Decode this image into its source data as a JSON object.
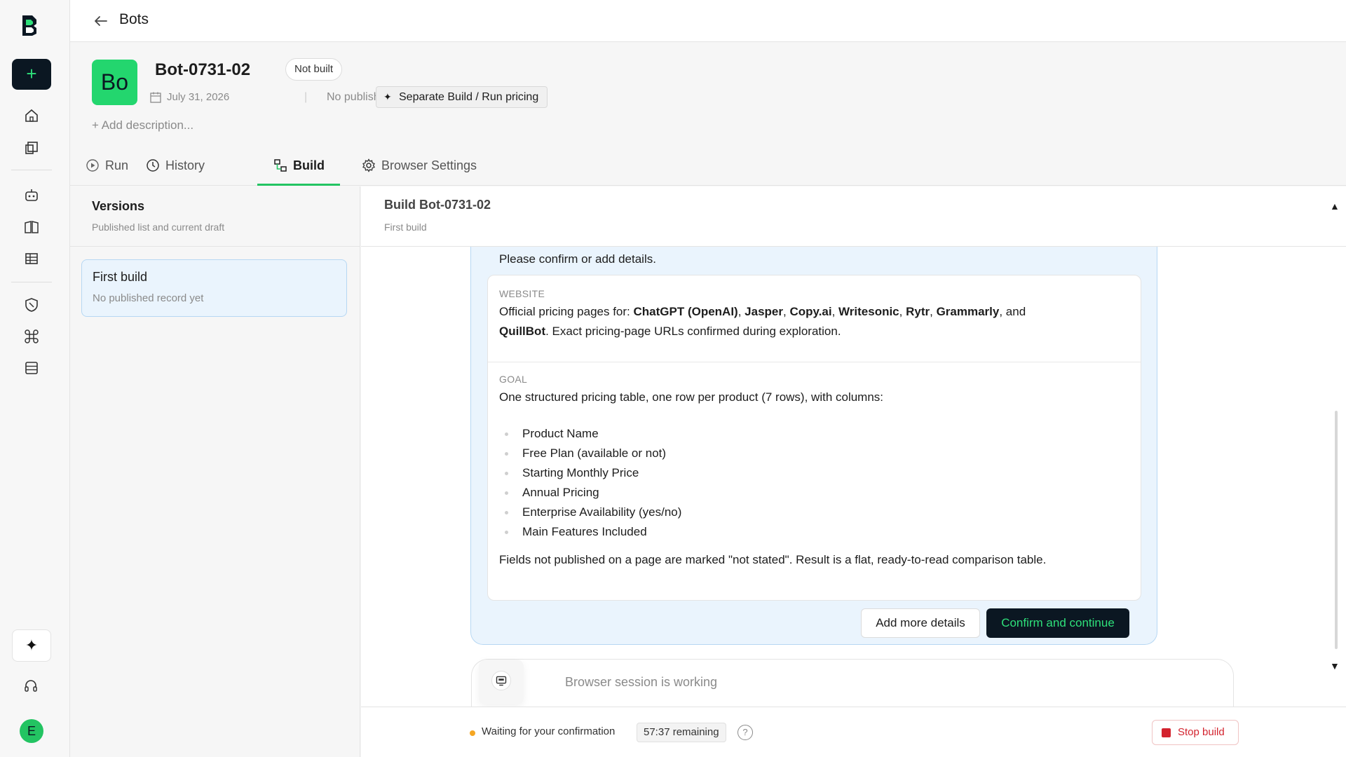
{
  "topbar": {
    "title": "Bots"
  },
  "rail": {
    "new_label": "+",
    "avatar_initial": "E"
  },
  "bot": {
    "avatar_text": "Bo",
    "name": "Bot-0731-02",
    "status": "Not built",
    "date": "July 31, 2026",
    "meta_sep": "|",
    "published": "No published record",
    "pricing_chip": "Separate Build / Run pricing",
    "add_description": "+ Add description..."
  },
  "tabs": [
    {
      "label": "Run",
      "icon": "play-circle-icon"
    },
    {
      "label": "History",
      "icon": "clock-icon"
    },
    {
      "label": "Build",
      "icon": "build-icon",
      "active": true
    },
    {
      "label": "Browser Settings",
      "icon": "gear-icon"
    }
  ],
  "versions": {
    "title": "Versions",
    "subtitle": "Published list and current draft",
    "items": [
      {
        "title": "First build",
        "subtitle": "No published record yet"
      }
    ]
  },
  "build": {
    "title": "Build Bot-0731-02",
    "subtitle": "First build",
    "prompt": "Please confirm or add details.",
    "website": {
      "label": "WEBSITE",
      "prefix": "Official pricing pages for: ",
      "products": [
        "ChatGPT (OpenAI)",
        "Jasper",
        "Copy.ai",
        "Writesonic",
        "Rytr",
        "Grammarly"
      ],
      "and_text": ", and ",
      "last_product": "QuillBot",
      "suffix": ". Exact pricing-page URLs confirmed during exploration."
    },
    "goal": {
      "label": "GOAL",
      "intro": "One structured pricing table, one row per product (7 rows), with columns:",
      "columns": [
        "Product Name",
        "Free Plan (available or not)",
        "Starting Monthly Price",
        "Annual Pricing",
        "Enterprise Availability (yes/no)",
        "Main Features Included"
      ],
      "note": "Fields not published on a page are marked \"not stated\". Result is a flat, ready-to-read comparison table."
    },
    "add_more_label": "Add more details",
    "confirm_label": "Confirm and continue",
    "session_text": "Browser session is working"
  },
  "status": {
    "waiting": "Waiting for your confirmation",
    "remaining": "57:37 remaining",
    "help": "?",
    "stop_label": "Stop build"
  },
  "colors": {
    "accent": "#23c462",
    "dark": "#0b1722",
    "selected_bg": "#eaf4fd",
    "danger": "#d3232e",
    "warning": "#f5a623"
  }
}
